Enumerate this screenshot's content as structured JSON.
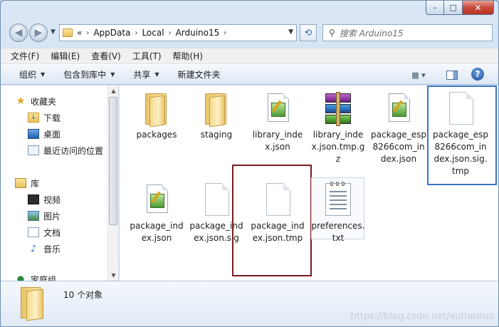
{
  "window": {
    "minimize_glyph": "–",
    "maximize_glyph": "□",
    "close_glyph": "✕"
  },
  "address_bar": {
    "overflow": "«",
    "crumbs": [
      "AppData",
      "Local",
      "Arduino15"
    ],
    "separator": "›"
  },
  "search": {
    "placeholder": "搜索 Arduino15"
  },
  "menu": [
    "文件(F)",
    "编辑(E)",
    "查看(V)",
    "工具(T)",
    "帮助(H)"
  ],
  "toolbar": {
    "organize": "组织",
    "include_in_library": "包含到库中",
    "share": "共享",
    "new_folder": "新建文件夹"
  },
  "nav_pane": {
    "favorites": "收藏夹",
    "downloads": "下载",
    "desktop": "桌面",
    "recent": "最近访问的位置",
    "libraries": "库",
    "videos": "视频",
    "pictures": "图片",
    "documents": "文档",
    "music": "音乐",
    "homegroup": "家庭组"
  },
  "files": [
    {
      "name": "packages",
      "type": "folder"
    },
    {
      "name": "staging",
      "type": "folder"
    },
    {
      "name": "library_index.json",
      "type": "json"
    },
    {
      "name": "library_index.json.tmp.gz",
      "type": "archive"
    },
    {
      "name": "package_esp8266com_index.json",
      "type": "json"
    },
    {
      "name": "package_esp8266com_index.json.sig.tmp",
      "type": "blank"
    },
    {
      "name": "package_index.json",
      "type": "json"
    },
    {
      "name": "package_index.json.sig",
      "type": "blank"
    },
    {
      "name": "package_index.json.tmp",
      "type": "blank"
    },
    {
      "name": "preferences.txt",
      "type": "text"
    }
  ],
  "details": {
    "count": "10 个对象"
  },
  "watermark": "https://blog.csdn.net/xutianruo"
}
